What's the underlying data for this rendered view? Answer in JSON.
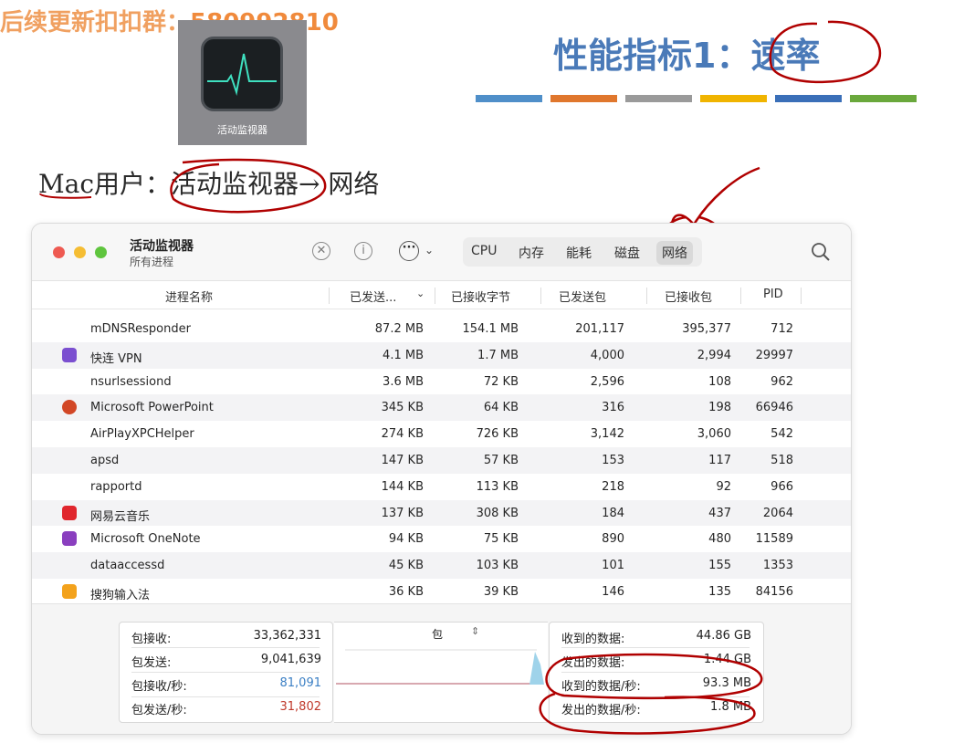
{
  "slide": {
    "watermark_prefix": "后续更新扣扣群：",
    "watermark_number": "580992810",
    "title": "性能指标1：速率",
    "subtitle": "Mac用户：活动监视器→ 网络",
    "colorbar": [
      "#4f8fc9",
      "#e0772d",
      "#9a9a9a",
      "#f0b400",
      "#3a6fb8",
      "#6aa83c"
    ]
  },
  "app_icon": {
    "label": "活动监视器",
    "icon": "activity-monitor-icon"
  },
  "window": {
    "title": "活动监视器",
    "subtitle": "所有进程",
    "tabs": [
      "CPU",
      "内存",
      "能耗",
      "磁盘",
      "网络"
    ],
    "active_tab": "网络",
    "columns": [
      "进程名称",
      "已发送...",
      "已接收字节",
      "已发送包",
      "已接收包",
      "PID"
    ],
    "rows": [
      {
        "icon": "",
        "name": "mDNSResponder",
        "sent": "87.2 MB",
        "recv": "154.1 MB",
        "pkt_out": "201,117",
        "pkt_in": "395,377",
        "pid": "712"
      },
      {
        "icon": "vpn-icon",
        "name": "快连 VPN",
        "sent": "4.1 MB",
        "recv": "1.7 MB",
        "pkt_out": "4,000",
        "pkt_in": "2,994",
        "pid": "29997"
      },
      {
        "icon": "",
        "name": "nsurlsessiond",
        "sent": "3.6 MB",
        "recv": "72 KB",
        "pkt_out": "2,596",
        "pkt_in": "108",
        "pid": "962"
      },
      {
        "icon": "powerpoint-icon",
        "name": "Microsoft PowerPoint",
        "sent": "345 KB",
        "recv": "64 KB",
        "pkt_out": "316",
        "pkt_in": "198",
        "pid": "66946"
      },
      {
        "icon": "",
        "name": "AirPlayXPCHelper",
        "sent": "274 KB",
        "recv": "726 KB",
        "pkt_out": "3,142",
        "pkt_in": "3,060",
        "pid": "542"
      },
      {
        "icon": "",
        "name": "apsd",
        "sent": "147 KB",
        "recv": "57 KB",
        "pkt_out": "153",
        "pkt_in": "117",
        "pid": "518"
      },
      {
        "icon": "",
        "name": "rapportd",
        "sent": "144 KB",
        "recv": "113 KB",
        "pkt_out": "218",
        "pkt_in": "92",
        "pid": "966"
      },
      {
        "icon": "netease-music-icon",
        "name": "网易云音乐",
        "sent": "137 KB",
        "recv": "308 KB",
        "pkt_out": "184",
        "pkt_in": "437",
        "pid": "2064"
      },
      {
        "icon": "onenote-icon",
        "name": "Microsoft OneNote",
        "sent": "94 KB",
        "recv": "75 KB",
        "pkt_out": "890",
        "pkt_in": "480",
        "pid": "11589"
      },
      {
        "icon": "",
        "name": "dataaccessd",
        "sent": "45 KB",
        "recv": "103 KB",
        "pkt_out": "101",
        "pkt_in": "155",
        "pid": "1353"
      },
      {
        "icon": "sogou-icon",
        "name": "搜狗输入法",
        "sent": "36 KB",
        "recv": "39 KB",
        "pkt_out": "146",
        "pkt_in": "135",
        "pid": "84156"
      }
    ],
    "stats_left": [
      {
        "label": "包接收:",
        "value": "33,362,331",
        "color": "#222222"
      },
      {
        "label": "包发送:",
        "value": "9,041,639",
        "color": "#222222"
      },
      {
        "label": "包接收/秒:",
        "value": "81,091",
        "color": "#3b7fc4"
      },
      {
        "label": "包发送/秒:",
        "value": "31,802",
        "color": "#c0392b"
      }
    ],
    "graph_selector": "包",
    "stats_right": [
      {
        "label": "收到的数据:",
        "value": "44.86 GB"
      },
      {
        "label": "发出的数据:",
        "value": "1.44 GB"
      },
      {
        "label": "收到的数据/秒:",
        "value": "93.3 MB"
      },
      {
        "label": "发出的数据/秒:",
        "value": "1.8 MB"
      }
    ]
  }
}
